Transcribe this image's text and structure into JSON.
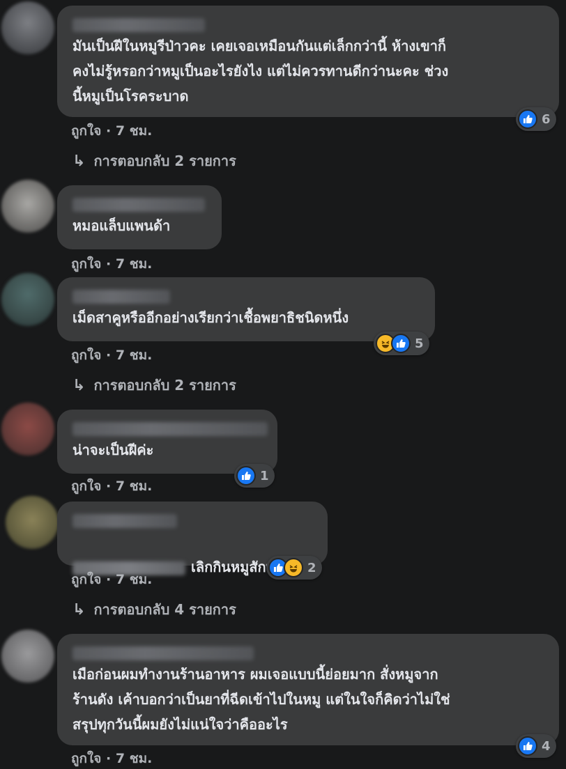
{
  "comments": [
    {
      "text": "มันเป็นฝีในหมูรีป่าวคะ เคยเจอเหมือนกันแต่เล็กกว่านี้ ห้างเขาก็\nคงไม่รู้หรอกว่าหมูเป็นอะไรยังไง แต่ไม่ควรทานดีกว่านะคะ ช่วง\nนี้หมูเป็นโรคระบาด",
      "like_label": "ถูกใจ",
      "time": "· 7 ชม.",
      "reactions": [
        "like-icon"
      ],
      "reaction_count": "6",
      "replies_label": "การตอบกลับ 2 รายการ"
    },
    {
      "text": "หมอแล็บแพนด้า",
      "like_label": "ถูกใจ",
      "time": "· 7 ชม."
    },
    {
      "text": "เม็ดสาคูหรืออีกอย่างเรียกว่าเชื้อพยาธิชนิดหนึ่ง",
      "like_label": "ถูกใจ",
      "time": "· 7 ชม.",
      "reactions": [
        "haha-icon",
        "like-icon"
      ],
      "reaction_count": "5",
      "replies_label": "การตอบกลับ 2 รายการ"
    },
    {
      "text": "น่าจะเป็นฝีค่ะ",
      "like_label": "ถูกใจ",
      "time": "· 7 ชม.",
      "reactions": [
        "like-icon"
      ],
      "reaction_count": "1"
    },
    {
      "text": "เลิกกินหมูสักพัก",
      "like_label": "ถูกใจ",
      "time": "· 7 ชม.",
      "reactions": [
        "like-icon",
        "haha-icon"
      ],
      "reaction_count": "2",
      "replies_label": "การตอบกลับ 4 รายการ"
    },
    {
      "text": "เมือก่อนผมทำงานร้านอาหาร ผมเจอแบบนี้ย่อยมาก สั่งหมูจาก\nร้านดัง เค้าบอกว่าเป็นยาที่ฉีดเข้าไปในหมู แต่ในใจก็คิดว่าไม่ใช่\nสรุปทุกวันนี้ผมยังไม่แน่ใจว่าคืออะไร",
      "like_label": "ถูกใจ",
      "time": "· 7 ชม.",
      "reactions": [
        "like-icon"
      ],
      "reaction_count": "4"
    }
  ],
  "colors": {
    "background": "#18191a",
    "bubble": "#3a3b3c",
    "text": "#e4e6eb",
    "secondary_text": "#b0b3b8",
    "like_blue": "#1877f2",
    "haha_yellow": "#f7b928"
  }
}
